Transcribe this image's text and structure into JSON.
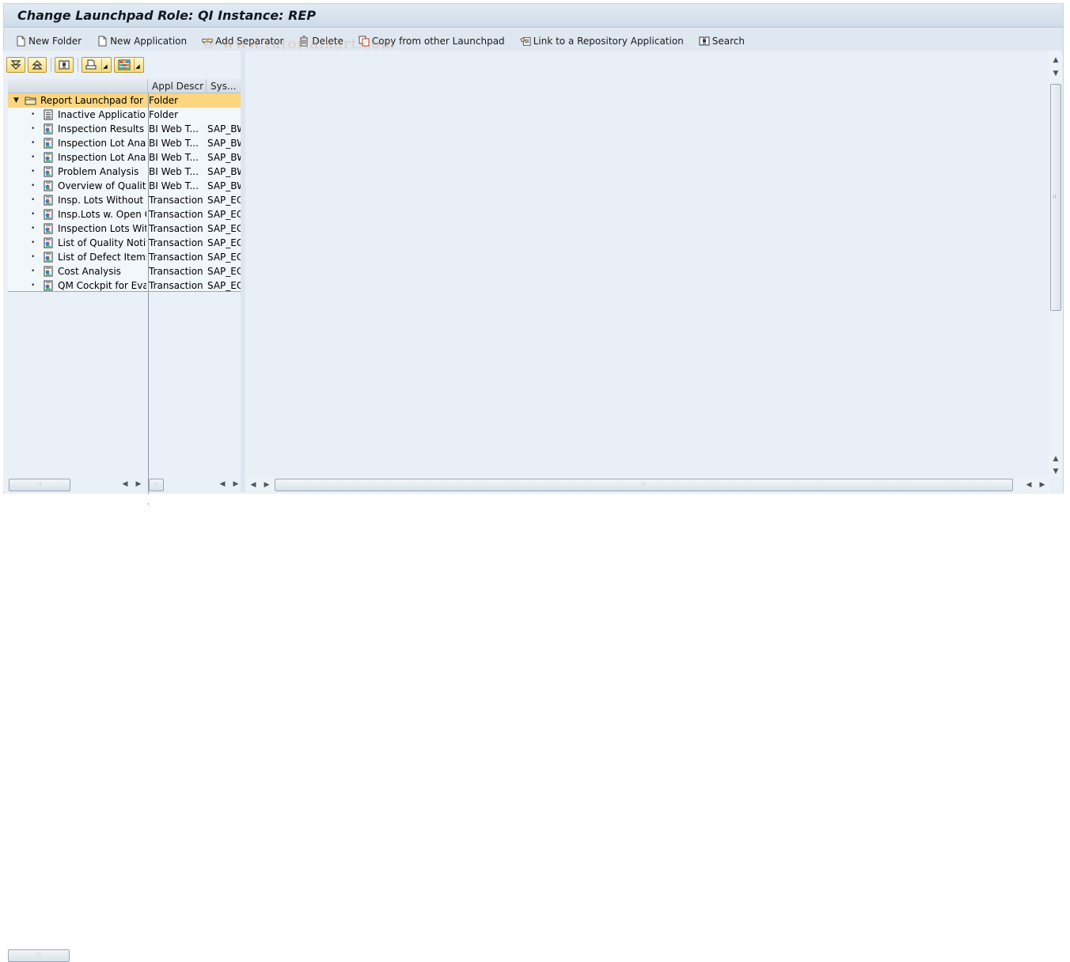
{
  "window": {
    "title": "Change Launchpad Role: QI Instance: REP"
  },
  "app_toolbar": {
    "buttons": [
      {
        "label": "New Folder",
        "icon": "new-document-icon"
      },
      {
        "label": "New Application",
        "icon": "new-document-icon"
      },
      {
        "label": "Add Separator",
        "icon": "separator-icon"
      },
      {
        "label": "Delete",
        "icon": "trash-icon"
      },
      {
        "label": "Copy from other Launchpad",
        "icon": "copy-icon"
      },
      {
        "label": "Link to a Repository Application",
        "icon": "link-repository-icon"
      },
      {
        "label": "Search",
        "icon": "binoculars-icon"
      }
    ]
  },
  "watermark": "© www.tutorialkart.com",
  "tree_toolbar": {
    "buttons": [
      "expand-all-icon",
      "collapse-all-icon",
      "find-icon",
      "print-icon",
      "layout-grid-icon"
    ]
  },
  "tree": {
    "columns": [
      "",
      "Appl Descr",
      "Sys..."
    ],
    "root": {
      "label": "Report Launchpad for Q",
      "type": "Folder",
      "system": "",
      "expanded": true,
      "selected": true
    },
    "rows": [
      {
        "label": "Inactive Applications",
        "type": "Folder",
        "system": "",
        "icon": "list-folder-icon"
      },
      {
        "label": "Inspection Results O",
        "type": "BI Web T...",
        "system": "SAP_BW",
        "icon": "report-icon"
      },
      {
        "label": "Inspection Lot Analy:",
        "type": "BI Web T...",
        "system": "SAP_BW",
        "icon": "report-icon"
      },
      {
        "label": "Inspection Lot Analy:",
        "type": "BI Web T...",
        "system": "SAP_BW",
        "icon": "report-icon"
      },
      {
        "label": "Problem Analysis",
        "type": "BI Web T...",
        "system": "SAP_BW",
        "icon": "report-icon"
      },
      {
        "label": "Overview of Quality I",
        "type": "BI Web T...",
        "system": "SAP_BW",
        "icon": "report-icon"
      },
      {
        "label": "Insp. Lots Without Ii",
        "type": "Transaction",
        "system": "SAP_ECC",
        "icon": "report-icon"
      },
      {
        "label": "Insp.Lots w. Open Q",
        "type": "Transaction",
        "system": "SAP_ECC",
        "icon": "report-icon"
      },
      {
        "label": "Inspection Lots With",
        "type": "Transaction",
        "system": "SAP_ECC",
        "icon": "report-icon"
      },
      {
        "label": "List of Quality Notific",
        "type": "Transaction",
        "system": "SAP_ECC",
        "icon": "report-icon"
      },
      {
        "label": "List of Defect Items",
        "type": "Transaction",
        "system": "SAP_ECC",
        "icon": "report-icon"
      },
      {
        "label": "Cost Analysis",
        "type": "Transaction",
        "system": "SAP_ECC",
        "icon": "report-icon"
      },
      {
        "label": "QM Cockpit for Evalu",
        "type": "Transaction",
        "system": "SAP_ECC",
        "icon": "report-icon"
      }
    ]
  }
}
